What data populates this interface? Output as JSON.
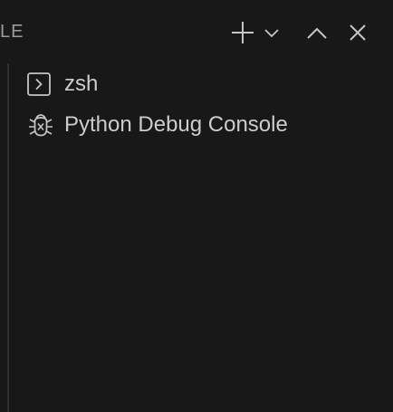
{
  "panel": {
    "title": "LE"
  },
  "actions": [
    {
      "name": "new-terminal",
      "icon": "plus-icon"
    },
    {
      "name": "terminal-profiles",
      "icon": "chevron-down-icon"
    },
    {
      "name": "maximize-panel",
      "icon": "chevron-up-icon"
    },
    {
      "name": "close-panel",
      "icon": "close-icon"
    }
  ],
  "terminals": [
    {
      "label": "zsh",
      "icon": "terminal-icon"
    },
    {
      "label": "Python Debug Console",
      "icon": "debug-bug-icon"
    }
  ],
  "colors": {
    "background": "#181818",
    "text": "#cccccc",
    "icon": "#c5c5c5",
    "muted": "#9d9d9d"
  }
}
